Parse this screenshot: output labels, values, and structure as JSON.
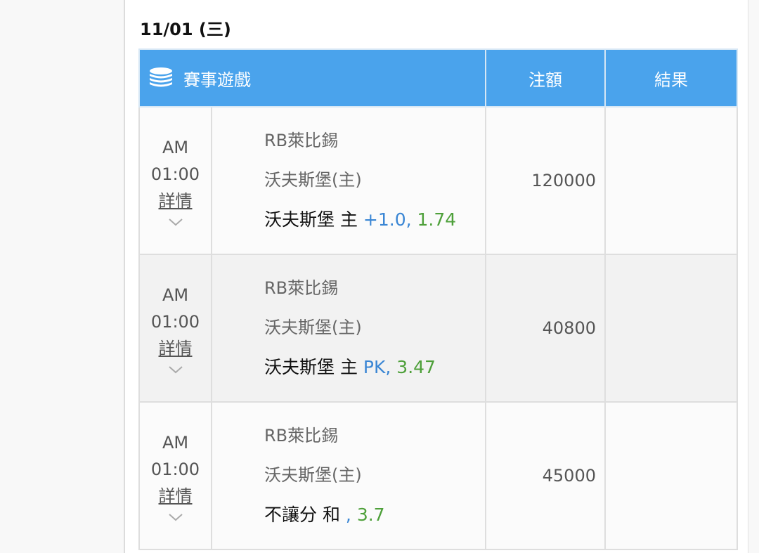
{
  "date_title": "11/01 (三)",
  "header": {
    "game_label": "賽事遊戲",
    "amount_label": "注額",
    "result_label": "結果"
  },
  "rows": [
    {
      "time_ampm": "AM",
      "time": "01:00",
      "detail_label": "詳情",
      "team_away": "RB萊比錫",
      "team_home": "沃夫斯堡(主)",
      "bet_pick": "沃夫斯堡 主 ",
      "handicap": "+1.0",
      "sep": ", ",
      "odds": "1.74",
      "amount": "120000",
      "result": ""
    },
    {
      "time_ampm": "AM",
      "time": "01:00",
      "detail_label": "詳情",
      "team_away": "RB萊比錫",
      "team_home": "沃夫斯堡(主)",
      "bet_pick": "沃夫斯堡 主 ",
      "handicap": "PK",
      "sep": ", ",
      "odds": "3.47",
      "amount": "40800",
      "result": ""
    },
    {
      "time_ampm": "AM",
      "time": "01:00",
      "detail_label": "詳情",
      "team_away": "RB萊比錫",
      "team_home": "沃夫斯堡(主)",
      "bet_pick": "不讓分 和 ",
      "handicap": "",
      "sep": ", ",
      "odds": "3.7",
      "amount": "45000",
      "result": ""
    }
  ],
  "colors": {
    "header_bg": "#4aa3ec",
    "handicap": "#3a86d4",
    "odds": "#4ea03a"
  },
  "icons": {
    "header_icon": "coin-stack-icon",
    "expand_icon": "chevron-down-icon"
  }
}
